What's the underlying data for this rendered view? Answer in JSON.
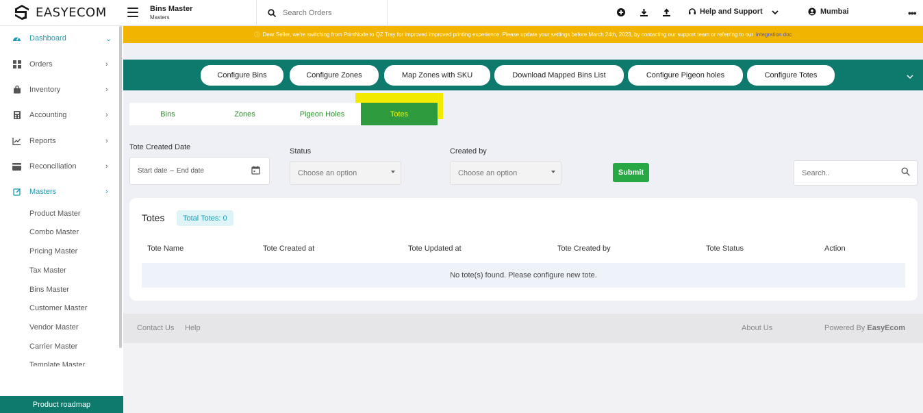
{
  "brand": {
    "name": "EASYECOM"
  },
  "header": {
    "title": "Bins Master",
    "subtitle": "Masters",
    "search_placeholder": "Search Orders",
    "help_label": "Help and Support",
    "user_location": "Mumbai",
    "more_glyph": "•••"
  },
  "sidebar": {
    "items": [
      {
        "label": "Dashboard",
        "chevron": "⌄"
      },
      {
        "label": "Orders",
        "chevron": "›"
      },
      {
        "label": "Inventory",
        "chevron": "›"
      },
      {
        "label": "Accounting",
        "chevron": "›"
      },
      {
        "label": "Reports",
        "chevron": "›"
      },
      {
        "label": "Reconciliation",
        "chevron": "›"
      },
      {
        "label": "Masters",
        "chevron": "›"
      }
    ],
    "sub_items": [
      "Product Master",
      "Combo Master",
      "Pricing Master",
      "Tax Master",
      "Bins Master",
      "Customer Master",
      "Vendor Master",
      "Carrier Master",
      "Template Master"
    ],
    "roadmap_label": "Product roadmap"
  },
  "notice": {
    "icon": "ⓘ",
    "text": "Dear Seller, we're switching from PrintNode to QZ Tray for improved improved printing experience. Please update your settings before March 24th, 2023, by contacting our support team or referring to our",
    "link_text": "integration doc"
  },
  "actions": [
    "Configure Bins",
    "Configure Zones",
    "Map Zones with SKU",
    "Download Mapped Bins List",
    "Configure Pigeon holes",
    "Configure Totes"
  ],
  "tabs": [
    "Bins",
    "Zones",
    "Pigeon Holes",
    "Totes"
  ],
  "active_tab": "Totes",
  "filters": {
    "date_label": "Tote Created Date",
    "start_placeholder": "Start date",
    "date_sep": "–",
    "end_placeholder": "End date",
    "status_label": "Status",
    "status_value": "Choose an option",
    "created_by_label": "Created by",
    "created_by_value": "Choose an option",
    "submit_label": "Submit",
    "search_placeholder": "Search.."
  },
  "totes_panel": {
    "title": "Totes",
    "total_badge": "Total Totes: 0",
    "columns": [
      "Tote Name",
      "Tote Created at",
      "Tote Updated at",
      "Tote Created by",
      "Tote Status",
      "Action"
    ],
    "empty_message": "No tote(s) found. Please configure new tote."
  },
  "footer": {
    "contact": "Contact Us",
    "help": "Help",
    "about": "About Us",
    "powered_prefix": "Powered By",
    "powered_brand": "EasyEcom"
  },
  "colors": {
    "primary_green": "#0e7a6d",
    "notice_yellow": "#f1b400",
    "accent_teal": "#1e9ab0",
    "submit_green": "#28a745"
  }
}
